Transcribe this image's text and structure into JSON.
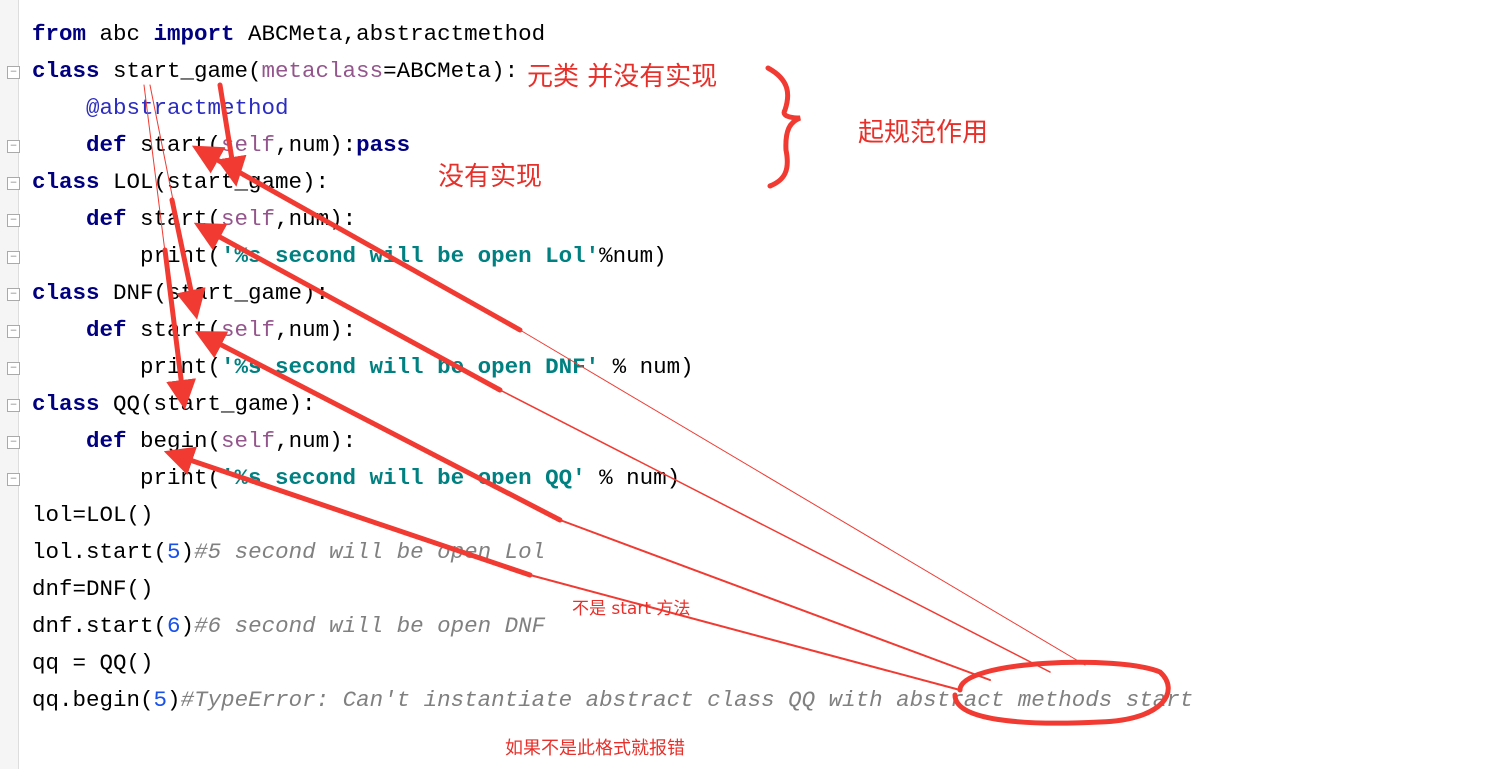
{
  "code": {
    "lines": [
      [
        {
          "t": "from",
          "c": "kw"
        },
        {
          "t": " abc "
        },
        {
          "t": "import",
          "c": "kw"
        },
        {
          "t": " ABCMeta,abstractmethod"
        }
      ],
      [
        {
          "t": "class",
          "c": "kw"
        },
        {
          "t": " start_game("
        },
        {
          "t": "metaclass",
          "c": "self"
        },
        {
          "t": "=ABCMeta):"
        }
      ],
      [
        {
          "t": "    "
        },
        {
          "t": "@abstractmethod",
          "c": "dec"
        }
      ],
      [
        {
          "t": "    "
        },
        {
          "t": "def",
          "c": "kw"
        },
        {
          "t": " start("
        },
        {
          "t": "self",
          "c": "self"
        },
        {
          "t": ",num):"
        },
        {
          "t": "pass",
          "c": "kw"
        }
      ],
      [
        {
          "t": "class",
          "c": "kw"
        },
        {
          "t": " LOL(start_game):"
        }
      ],
      [
        {
          "t": "    "
        },
        {
          "t": "def",
          "c": "kw"
        },
        {
          "t": " start("
        },
        {
          "t": "self",
          "c": "self"
        },
        {
          "t": ",num):"
        }
      ],
      [
        {
          "t": "        print("
        },
        {
          "t": "'%s second will be open Lol'",
          "c": "str"
        },
        {
          "t": "%num)"
        }
      ],
      [
        {
          "t": "class",
          "c": "kw"
        },
        {
          "t": " DNF(start_game):"
        }
      ],
      [
        {
          "t": "    "
        },
        {
          "t": "def",
          "c": "kw"
        },
        {
          "t": " start("
        },
        {
          "t": "self",
          "c": "self"
        },
        {
          "t": ",num):"
        }
      ],
      [
        {
          "t": "        print("
        },
        {
          "t": "'%s second will be open DNF'",
          "c": "str"
        },
        {
          "t": " % num)"
        }
      ],
      [
        {
          "t": "class",
          "c": "kw"
        },
        {
          "t": " QQ(start_game):"
        }
      ],
      [
        {
          "t": "    "
        },
        {
          "t": "def",
          "c": "kw"
        },
        {
          "t": " begin("
        },
        {
          "t": "self",
          "c": "self"
        },
        {
          "t": ",num):"
        }
      ],
      [
        {
          "t": "        print("
        },
        {
          "t": "'%s second will be open QQ'",
          "c": "str"
        },
        {
          "t": " % num)"
        }
      ],
      [
        {
          "t": "lol=LOL()"
        }
      ],
      [
        {
          "t": "lol.start("
        },
        {
          "t": "5",
          "c": "num"
        },
        {
          "t": ")"
        },
        {
          "t": "#5 second will be open Lol",
          "c": "cmt"
        }
      ],
      [
        {
          "t": "dnf=DNF()"
        }
      ],
      [
        {
          "t": "dnf.start("
        },
        {
          "t": "6",
          "c": "num"
        },
        {
          "t": ")"
        },
        {
          "t": "#6 second will be open DNF",
          "c": "cmt"
        }
      ],
      [
        {
          "t": "qq = QQ()"
        }
      ],
      [
        {
          "t": "qq.begin("
        },
        {
          "t": "5",
          "c": "num"
        },
        {
          "t": ")"
        },
        {
          "t": "#TypeError: Can't instantiate abstract class QQ with abstract methods start",
          "c": "cmt"
        }
      ]
    ]
  },
  "annotations": {
    "metaclass_note": "元类 并没有实现",
    "norm_note": "起规范作用",
    "not_implemented": "没有实现",
    "not_start_method": "不是 start 方法",
    "error_note": "如果不是此格式就报错"
  },
  "colors": {
    "annotation": "#e8302a",
    "keyword": "#000080",
    "string": "#008080",
    "comment": "#808080"
  }
}
